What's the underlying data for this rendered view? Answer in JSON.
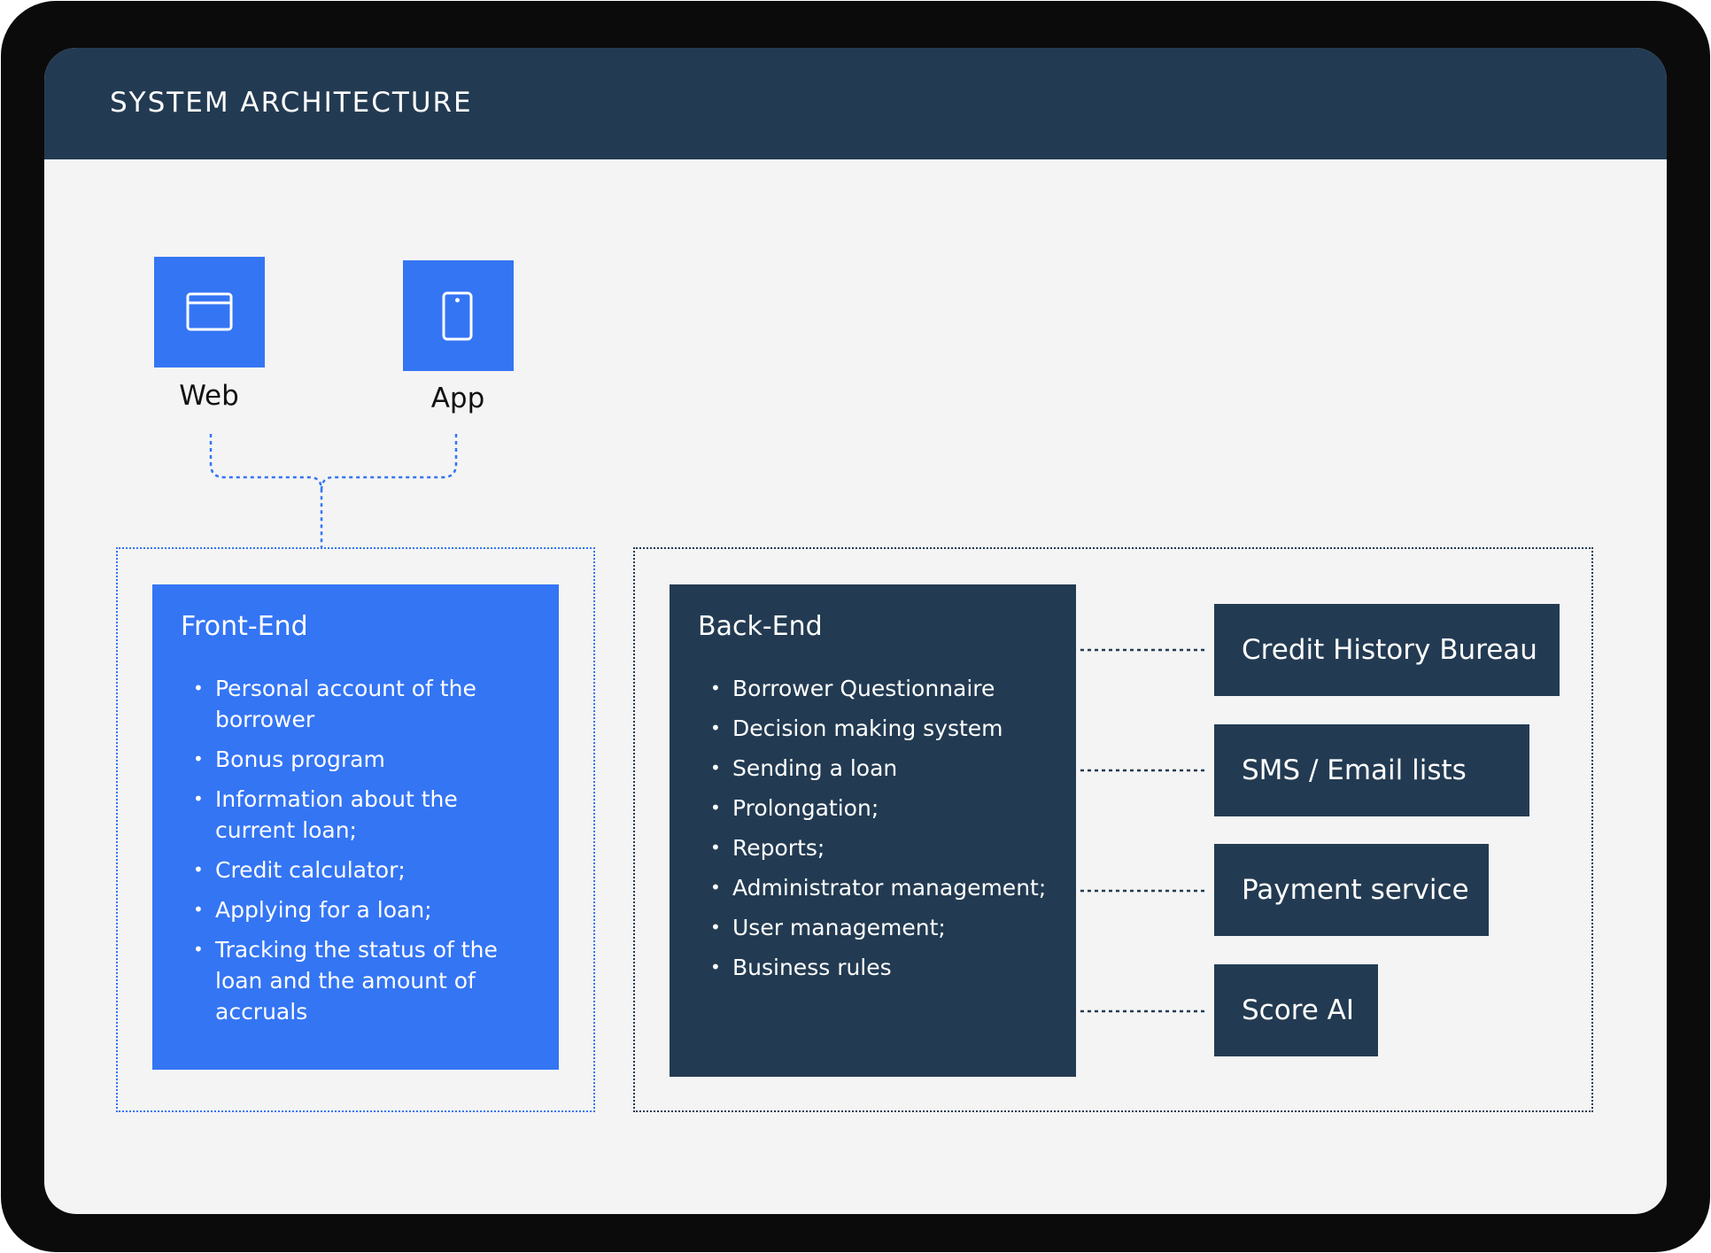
{
  "header": {
    "title": "SYSTEM ARCHITECTURE"
  },
  "clients": [
    {
      "label": "Web",
      "icon": "browser-window-icon"
    },
    {
      "label": "App",
      "icon": "mobile-phone-icon"
    }
  ],
  "frontend": {
    "title": "Front-End",
    "items": [
      "Personal account of the borrower",
      "Bonus program",
      "Information about the current loan;",
      "Credit calculator;",
      "Applying for a loan;",
      "Tracking the status of the loan and the amount of accruals"
    ]
  },
  "backend": {
    "title": "Back-End",
    "items": [
      "Borrower Questionnaire",
      "Decision making system",
      "Sending a loan",
      "Prolongation;",
      "Reports;",
      "Administrator management;",
      "User management;",
      "Business rules"
    ]
  },
  "services": [
    "Credit History Bureau",
    "SMS / Email lists",
    "Payment service",
    "Score AI"
  ],
  "colors": {
    "frame": "#0b0b0b",
    "header": "#233b52",
    "accent_blue": "#3475f4",
    "dark_navy": "#233b52",
    "canvas": "#f4f4f4"
  }
}
